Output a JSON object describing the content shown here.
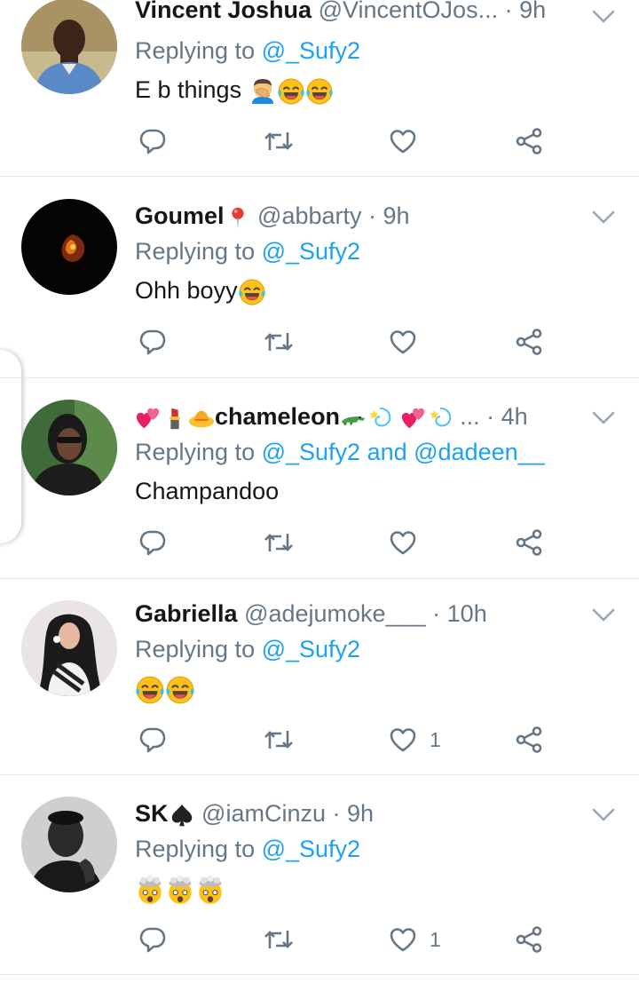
{
  "tweets": [
    {
      "name": "Vincent Joshua",
      "handle": "@VincentOJos...",
      "dot": "·",
      "time": "9h",
      "replying_prefix": "Replying to ",
      "mentions": "@_Sufy2",
      "text": "E b things",
      "emojis": [
        "facepalm-emoji",
        "tears-of-joy-emoji",
        "tears-of-joy-emoji"
      ],
      "likes": ""
    },
    {
      "name": "Goumel",
      "name_emoji": "pin-emoji",
      "handle": "@abbarty",
      "dot": "·",
      "time": "9h",
      "replying_prefix": "Replying to ",
      "mentions": "@_Sufy2",
      "text": "Ohh boyy",
      "emojis": [
        "tears-of-joy-emoji"
      ],
      "likes": ""
    },
    {
      "name_prefix_emojis": [
        "hearts-emoji",
        "lipstick-emoji",
        "hat-emoji"
      ],
      "name": "chameleon",
      "name_suffix_emojis": [
        "crocodile-emoji",
        "dizzy-emoji",
        "hearts-emoji",
        "dizzy-emoji"
      ],
      "handle": "...",
      "dot": "·",
      "time": "4h",
      "replying_prefix": "Replying to ",
      "mentions": "@_Sufy2 and @dadeen__",
      "text": "Champandoo",
      "emojis": [],
      "likes": ""
    },
    {
      "name": "Gabriella",
      "handle": "@adejumoke___",
      "dot": "·",
      "time": "10h",
      "replying_prefix": "Replying to ",
      "mentions": "@_Sufy2",
      "text": "",
      "emojis": [
        "tears-of-joy-emoji",
        "tears-of-joy-emoji"
      ],
      "likes": "1"
    },
    {
      "name": "SK",
      "name_emoji": "spade-emoji",
      "handle": "@iamCinzu",
      "dot": "·",
      "time": "9h",
      "replying_prefix": "Replying to ",
      "mentions": "@_Sufy2",
      "text": "",
      "emojis": [
        "exploding-head-emoji",
        "exploding-head-emoji",
        "exploding-head-emoji"
      ],
      "likes": "1"
    }
  ],
  "colors": {
    "link": "#1da1f2",
    "muted": "#657786",
    "text": "#14171a",
    "divider": "#e1e8ed"
  },
  "icons": [
    "reply-icon",
    "retweet-icon",
    "like-icon",
    "share-icon",
    "chevron-down-icon"
  ]
}
